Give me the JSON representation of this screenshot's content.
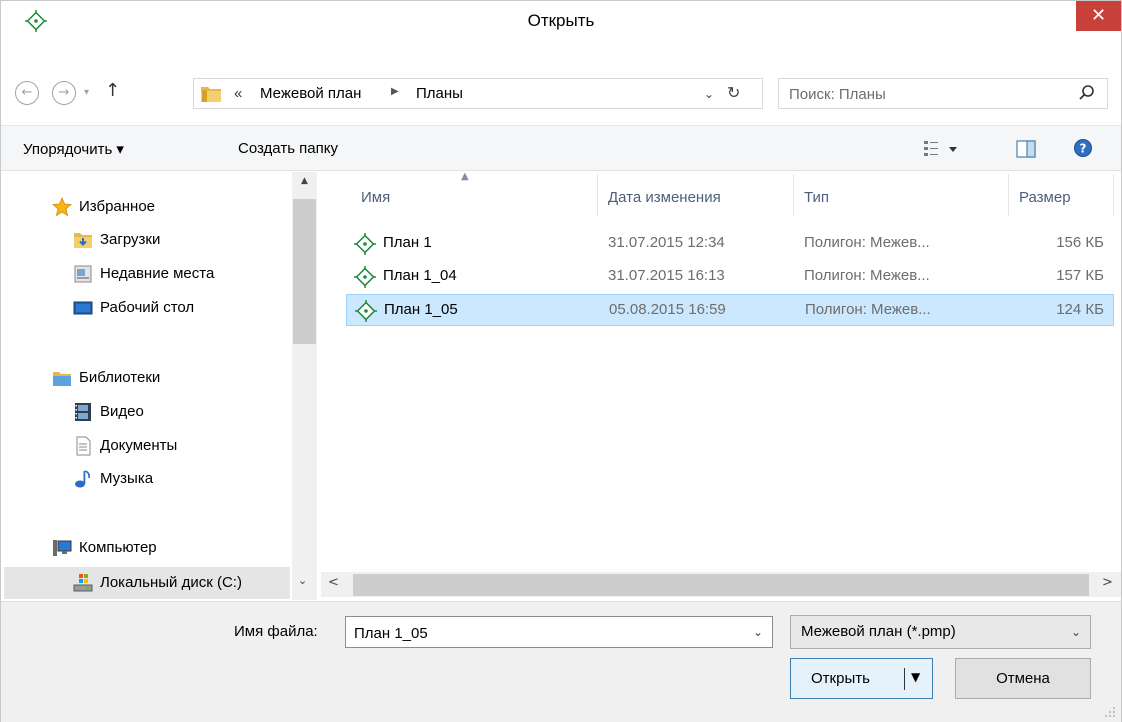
{
  "window": {
    "title": "Открыть",
    "close_glyph": "✕"
  },
  "nav": {
    "back_glyph": "←",
    "forward_glyph": "→",
    "history_glyph": "▾",
    "up_glyph": "↑",
    "breadcrumb_prefix": "«",
    "breadcrumb": [
      "Межевой план",
      "Планы"
    ],
    "breadcrumb_sep": "▶",
    "address_dropdown_glyph": "⌄",
    "refresh_glyph": "↻",
    "search_placeholder": "Поиск: Планы"
  },
  "toolbar": {
    "organize": "Упорядочить ▾",
    "new_folder": "Создать папку"
  },
  "sidebar": {
    "favorites": {
      "label": "Избранное",
      "icon": "star-icon"
    },
    "favorites_items": [
      {
        "label": "Загрузки",
        "icon": "downloads-icon"
      },
      {
        "label": "Недавние места",
        "icon": "recent-places-icon"
      },
      {
        "label": "Рабочий стол",
        "icon": "desktop-icon"
      }
    ],
    "libraries": {
      "label": "Библиотеки",
      "icon": "libraries-icon"
    },
    "libraries_items": [
      {
        "label": "Видео",
        "icon": "video-icon"
      },
      {
        "label": "Документы",
        "icon": "documents-icon"
      },
      {
        "label": "Музыка",
        "icon": "music-icon"
      }
    ],
    "computer": {
      "label": "Компьютер",
      "icon": "computer-icon"
    },
    "computer_items": [
      {
        "label": "Локальный диск (C:)",
        "icon": "local-disk-icon"
      }
    ],
    "scroll_up_glyph": "▲",
    "expand_glyph": "⌄"
  },
  "file_list": {
    "columns": [
      "Имя",
      "Дата изменения",
      "Тип",
      "Размер"
    ],
    "sort_glyph": "▲",
    "rows": [
      {
        "name": "План 1",
        "date": "31.07.2015 12:34",
        "type": "Полигон: Межев...",
        "size": "156 КБ",
        "selected": false
      },
      {
        "name": "План 1_04",
        "date": "31.07.2015 16:13",
        "type": "Полигон: Межев...",
        "size": "157 КБ",
        "selected": false
      },
      {
        "name": "План 1_05",
        "date": "05.08.2015 16:59",
        "type": "Полигон: Межев...",
        "size": "124 КБ",
        "selected": true
      }
    ],
    "hscroll_left_glyph": "<",
    "hscroll_right_glyph": ">"
  },
  "bottom": {
    "filename_label": "Имя файла:",
    "filename_value": "План 1_05",
    "filename_dropdown_glyph": "⌄",
    "filetype": "Межевой план (*.pmp)",
    "filetype_dropdown_glyph": "⌄",
    "open": "Открыть",
    "open_split_glyph": "▼",
    "cancel": "Отмена"
  },
  "colors": {
    "accent": "#0078d7",
    "selection_bg": "#cce8ff",
    "selection_border": "#99d1ff",
    "close_red": "#c7413a",
    "plan_icon_green": "#1e8a3c"
  }
}
